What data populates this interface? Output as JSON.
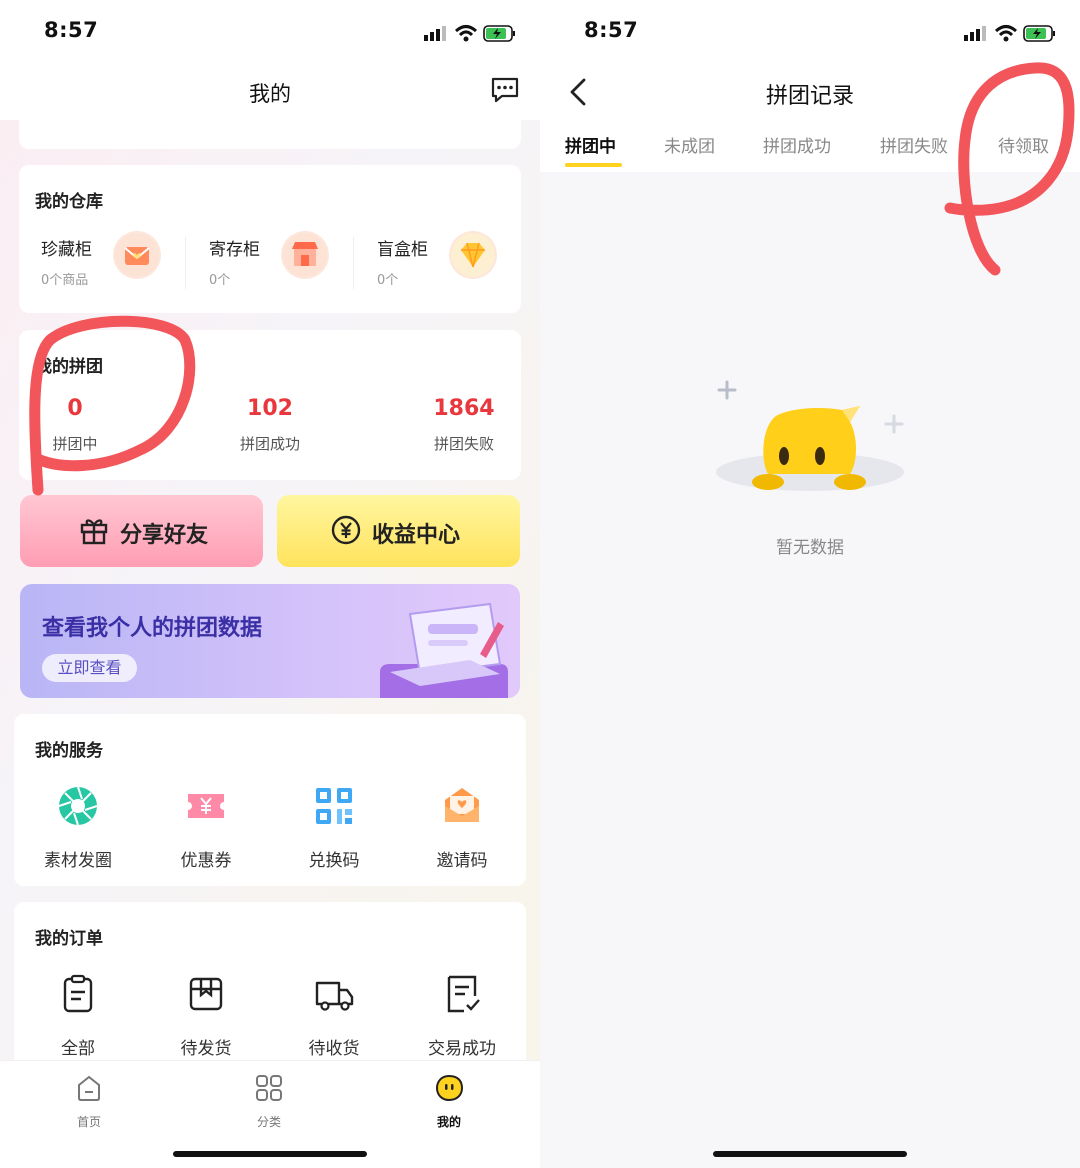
{
  "left": {
    "status": {
      "time": "8:57"
    },
    "header": {
      "title": "我的",
      "message_icon": "message-icon"
    },
    "warehouse": {
      "title": "我的仓库",
      "items": [
        {
          "name": "珍藏柜",
          "sub": "0个商品",
          "icon": "envelope-heart-icon"
        },
        {
          "name": "寄存柜",
          "sub": "0个",
          "icon": "storefront-icon"
        },
        {
          "name": "盲盒柜",
          "sub": "0个",
          "icon": "diamond-icon"
        }
      ]
    },
    "group": {
      "title": "我的拼团",
      "stats": [
        {
          "value": "0",
          "label": "拼团中"
        },
        {
          "value": "102",
          "label": "拼团成功"
        },
        {
          "value": "1864",
          "label": "拼团失败"
        }
      ]
    },
    "actions": {
      "share": "分享好友",
      "income": "收益中心"
    },
    "banner": {
      "title": "查看我个人的拼团数据",
      "button": "立即查看"
    },
    "services": {
      "title": "我的服务",
      "items": [
        {
          "label": "素材发圈",
          "icon": "aperture-icon"
        },
        {
          "label": "优惠券",
          "icon": "coupon-icon"
        },
        {
          "label": "兑换码",
          "icon": "qr-code-icon"
        },
        {
          "label": "邀请码",
          "icon": "invite-envelope-icon"
        }
      ]
    },
    "orders": {
      "title": "我的订单",
      "items": [
        {
          "label": "全部",
          "icon": "clipboard-icon"
        },
        {
          "label": "待发货",
          "icon": "box-icon"
        },
        {
          "label": "待收货",
          "icon": "truck-icon"
        },
        {
          "label": "交易成功",
          "icon": "receipt-check-icon"
        }
      ]
    },
    "tabbar": {
      "items": [
        {
          "label": "首页",
          "icon": "home-icon"
        },
        {
          "label": "分类",
          "icon": "grid-icon"
        },
        {
          "label": "我的",
          "icon": "smiley-icon"
        }
      ],
      "active": "我的"
    }
  },
  "right": {
    "status": {
      "time": "8:57"
    },
    "header": {
      "title": "拼团记录"
    },
    "tabs": [
      "拼团中",
      "未成团",
      "拼团成功",
      "拼团失败",
      "待领取"
    ],
    "active_tab": "拼团中",
    "empty_text": "暂无数据"
  },
  "colors": {
    "accent": "#ffd21f",
    "stat_red": "#e8373d",
    "banner_text": "#3a2fa5"
  }
}
